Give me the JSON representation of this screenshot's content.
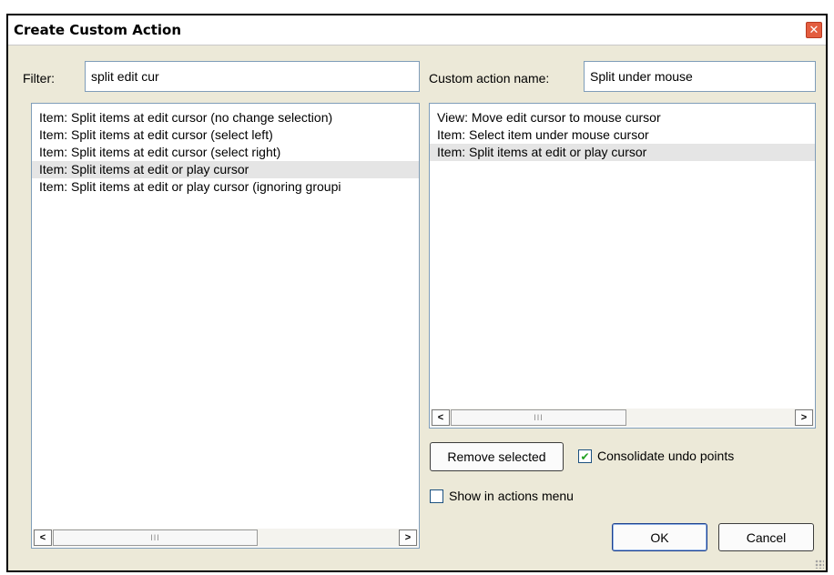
{
  "window": {
    "title": "Create Custom Action",
    "close_glyph": "✕"
  },
  "filter": {
    "label": "Filter:",
    "value": "split edit cur"
  },
  "custom_name": {
    "label": "Custom action name:",
    "value": "Split under mouse"
  },
  "left_list": {
    "items": [
      {
        "label": "Item: Split items at edit cursor (no change selection)",
        "selected": false
      },
      {
        "label": "Item: Split items at edit cursor (select left)",
        "selected": false
      },
      {
        "label": "Item: Split items at edit cursor (select right)",
        "selected": false
      },
      {
        "label": "Item: Split items at edit or play cursor",
        "selected": true
      },
      {
        "label": "Item: Split items at edit or play cursor (ignoring groupi",
        "selected": false
      }
    ]
  },
  "right_list": {
    "items": [
      {
        "label": "View: Move edit cursor to mouse cursor",
        "selected": false
      },
      {
        "label": "Item: Select item under mouse cursor",
        "selected": false
      },
      {
        "label": "Item: Split items at edit or play cursor",
        "selected": true
      }
    ]
  },
  "scrollbar": {
    "left_arrow": "<",
    "right_arrow": ">",
    "thumb_grip": "III"
  },
  "buttons": {
    "remove_selected": "Remove selected",
    "ok": "OK",
    "cancel": "Cancel"
  },
  "consolidate_undo": {
    "label": "Consolidate undo points",
    "checked": true,
    "check_glyph": "✔"
  },
  "show_in_menu": {
    "label": "Show in actions menu",
    "checked": false
  }
}
